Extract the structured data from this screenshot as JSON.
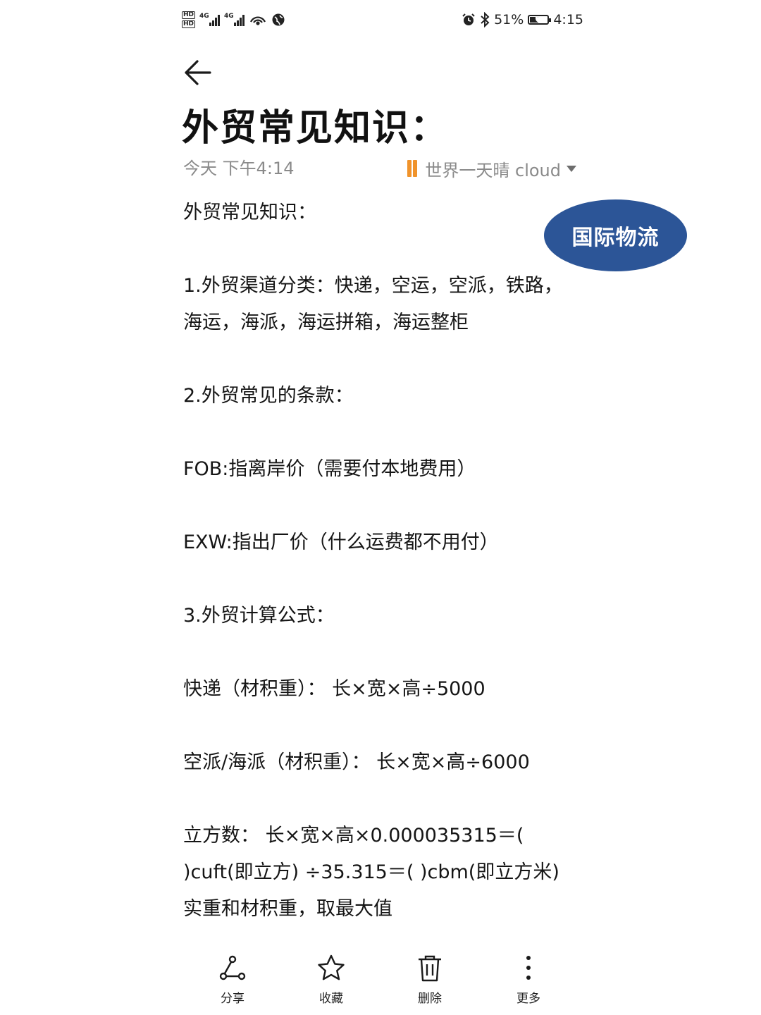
{
  "status_bar": {
    "hd_labels": [
      "HD",
      "HD"
    ],
    "network_labels": [
      "4G",
      "4G"
    ],
    "battery_percent": "51%",
    "battery_level": 0.51,
    "time": "4:15",
    "left_icons": [
      "hd-icon",
      "signal-icon",
      "signal-icon",
      "wifi-hotspot-icon",
      "globe-icon"
    ],
    "right_icons": [
      "alarm-icon",
      "bluetooth-icon",
      "battery-icon"
    ]
  },
  "header": {
    "back_icon": "arrow-left-icon",
    "title": "外贸常见知识：",
    "date": "今天 下午4:14",
    "notebook": "世界一天晴 cloud"
  },
  "badge": {
    "label": "国际物流",
    "color": "#2c5597"
  },
  "content": {
    "lines": [
      "外贸常见知识：",
      "",
      "1.外贸渠道分类：快递，空运，空派，铁路，海运，海派，海运拼箱，海运整柜",
      "",
      "2.外贸常见的条款：",
      "",
      "FOB:指离岸价（需要付本地费用）",
      "",
      "EXW:指出厂价（什么运费都不用付）",
      "",
      "3.外贸计算公式：",
      "",
      "快递（材积重）： 长×宽×高÷5000",
      "",
      "空派/海派（材积重）： 长×宽×高÷6000",
      "",
      "立方数： 长×宽×高×0.000035315＝(    )cuft(即立方) ÷35.315＝(     )cbm(即立方米)",
      "实重和材积重，取最大值"
    ]
  },
  "toolbar": {
    "share": "分享",
    "favorite": "收藏",
    "delete": "删除",
    "more": "更多"
  },
  "colors": {
    "text": "#151515",
    "meta": "#8a8a8a",
    "notebook_icon": "#f0932b",
    "badge": "#2c5597"
  }
}
